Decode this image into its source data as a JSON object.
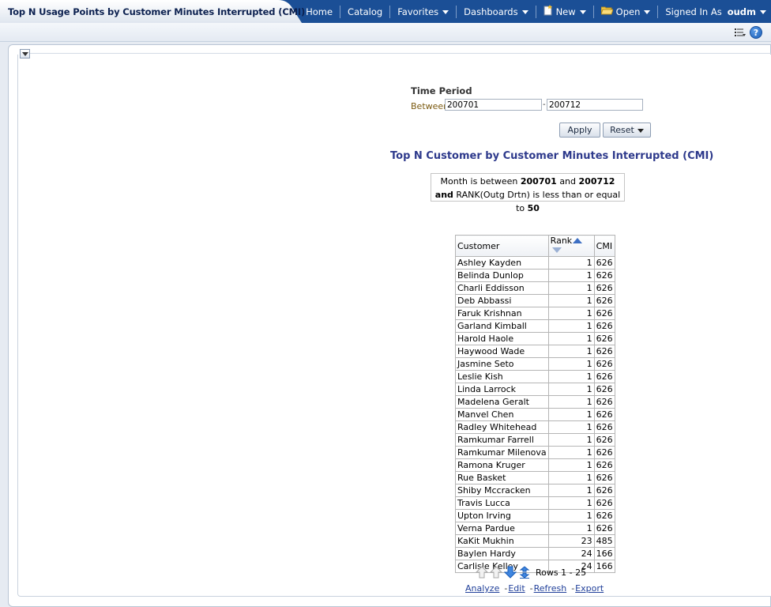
{
  "header": {
    "title": "Top N Usage Points by Customer Minutes Interrupted (CMI)",
    "nav": {
      "home": "Home",
      "catalog": "Catalog",
      "favorites": "Favorites",
      "dashboards": "Dashboards",
      "new": "New",
      "open": "Open",
      "signed_in_as": "Signed In As",
      "user": "oudm"
    }
  },
  "prompt": {
    "label": "Time Period",
    "operator": "Between",
    "from_value": "200701",
    "separator": "-",
    "to_value": "200712",
    "apply_label": "Apply",
    "reset_label": "Reset"
  },
  "report": {
    "title": "Top N Customer by Customer Minutes Interrupted (CMI)",
    "filter": {
      "line1_prefix": "Month is between",
      "from": "200701",
      "and_word": "and",
      "to": "200712",
      "line2_and": "and",
      "line2_text": "RANK(Outg Drtn) is less than or equal to",
      "limit": "50"
    },
    "columns": [
      "Customer",
      "Rank",
      "CMI"
    ],
    "rows": [
      [
        "Ashley Kayden",
        "1",
        "626"
      ],
      [
        "Belinda Dunlop",
        "1",
        "626"
      ],
      [
        "Charli Eddisson",
        "1",
        "626"
      ],
      [
        "Deb Abbassi",
        "1",
        "626"
      ],
      [
        "Faruk Krishnan",
        "1",
        "626"
      ],
      [
        "Garland Kimball",
        "1",
        "626"
      ],
      [
        "Harold Haole",
        "1",
        "626"
      ],
      [
        "Haywood Wade",
        "1",
        "626"
      ],
      [
        "Jasmine Seto",
        "1",
        "626"
      ],
      [
        "Leslie Kish",
        "1",
        "626"
      ],
      [
        "Linda Larrock",
        "1",
        "626"
      ],
      [
        "Madelena Geralt",
        "1",
        "626"
      ],
      [
        "Manvel Chen",
        "1",
        "626"
      ],
      [
        "Radley Whitehead",
        "1",
        "626"
      ],
      [
        "Ramkumar Farrell",
        "1",
        "626"
      ],
      [
        "Ramkumar Milenova",
        "1",
        "626"
      ],
      [
        "Ramona Kruger",
        "1",
        "626"
      ],
      [
        "Rue Basket",
        "1",
        "626"
      ],
      [
        "Shiby Mccracken",
        "1",
        "626"
      ],
      [
        "Travis Lucca",
        "1",
        "626"
      ],
      [
        "Upton Irving",
        "1",
        "626"
      ],
      [
        "Verna Pardue",
        "1",
        "626"
      ],
      [
        "KaKit Mukhin",
        "23",
        "485"
      ],
      [
        "Baylen Hardy",
        "24",
        "166"
      ],
      [
        "Carlisle Kelley",
        "24",
        "166"
      ]
    ],
    "paging_label": "Rows 1 - 25",
    "links": {
      "analyze": "Analyze",
      "edit": "Edit",
      "refresh": "Refresh",
      "export": "Export"
    }
  },
  "colors": {
    "top_bar": "#1b4f96",
    "report_title": "#2e3a8c",
    "link": "#21409a"
  },
  "icons": [
    "new-icon",
    "folder-icon",
    "list-icon",
    "help-icon",
    "collapse-icon",
    "sort-asc-icon",
    "sort-desc-icon",
    "page-up-icon",
    "page-down-icon",
    "show-all-icon"
  ]
}
